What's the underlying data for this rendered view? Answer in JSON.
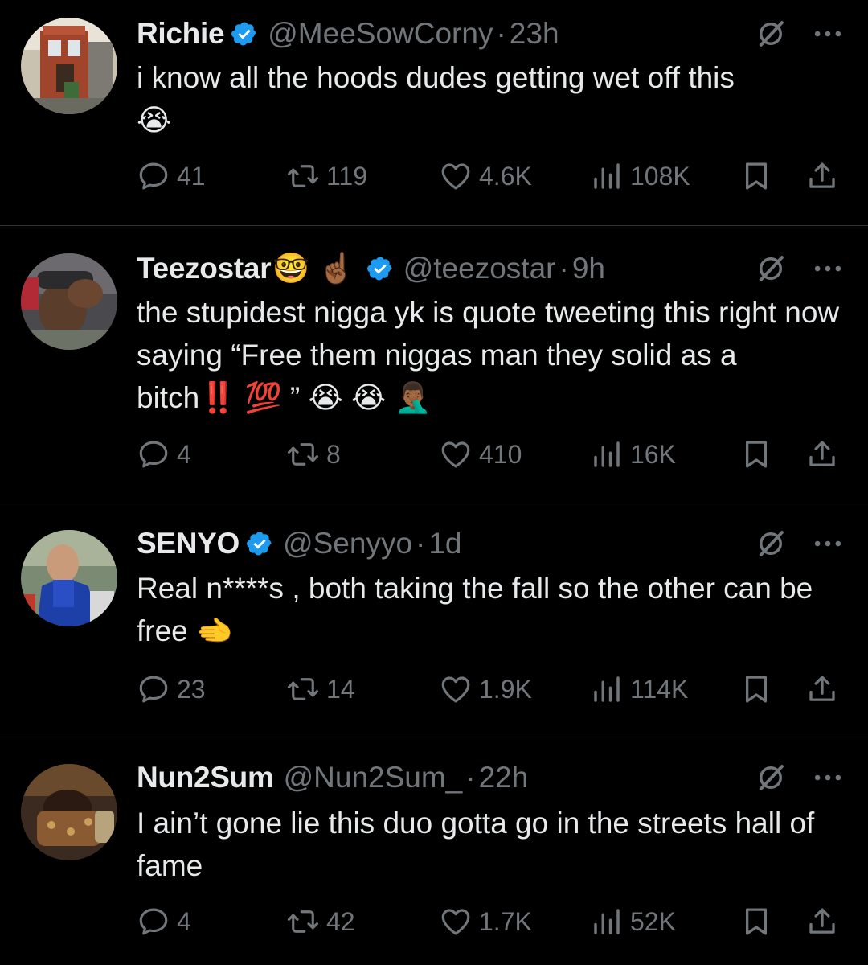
{
  "tweets": [
    {
      "display_name": "Richie",
      "handle": "@MeeSowCorny",
      "separator": "·",
      "time": "23h",
      "text": "i know all the hoods dudes getting wet off this",
      "text_emoji": "😭",
      "replies": "41",
      "retweets": "119",
      "likes": "4.6K",
      "views": "108K"
    },
    {
      "display_name": "Teezostar",
      "name_emojis": "🤓 ☝🏾",
      "handle": "@teezostar",
      "separator": "·",
      "time": "9h",
      "text": "the stupidest nigga yk is quote tweeting this right now saying “Free them niggas man they solid as a bitch‼️ 💯 ” 😭 😭 🤦🏾‍♂️",
      "replies": "4",
      "retweets": "8",
      "likes": "410",
      "views": "16K"
    },
    {
      "display_name": "SENYO",
      "handle": "@Senyyo",
      "separator": "·",
      "time": "1d",
      "text": "Real n****s , both taking the fall so the other can be free 🫲",
      "replies": "23",
      "retweets": "14",
      "likes": "1.9K",
      "views": "114K"
    },
    {
      "display_name": "Nun2Sum",
      "handle": "@Nun2Sum_",
      "separator": "·",
      "time": "22h",
      "text": "I ain’t gone lie this duo gotta go in the streets hall of fame",
      "replies": "4",
      "retweets": "42",
      "likes": "1.7K",
      "views": "52K"
    }
  ],
  "colors": {
    "background": "#000000",
    "text_primary": "#e7e9ea",
    "text_secondary": "#71767b",
    "divider": "#2f3336",
    "verified": "#1d9bf0"
  },
  "icons": {
    "verified": "verified-badge-icon",
    "grok": "grok-icon",
    "more": "more-icon",
    "reply": "reply-icon",
    "retweet": "retweet-icon",
    "like": "like-icon",
    "views": "views-icon",
    "bookmark": "bookmark-icon",
    "share": "share-icon"
  }
}
